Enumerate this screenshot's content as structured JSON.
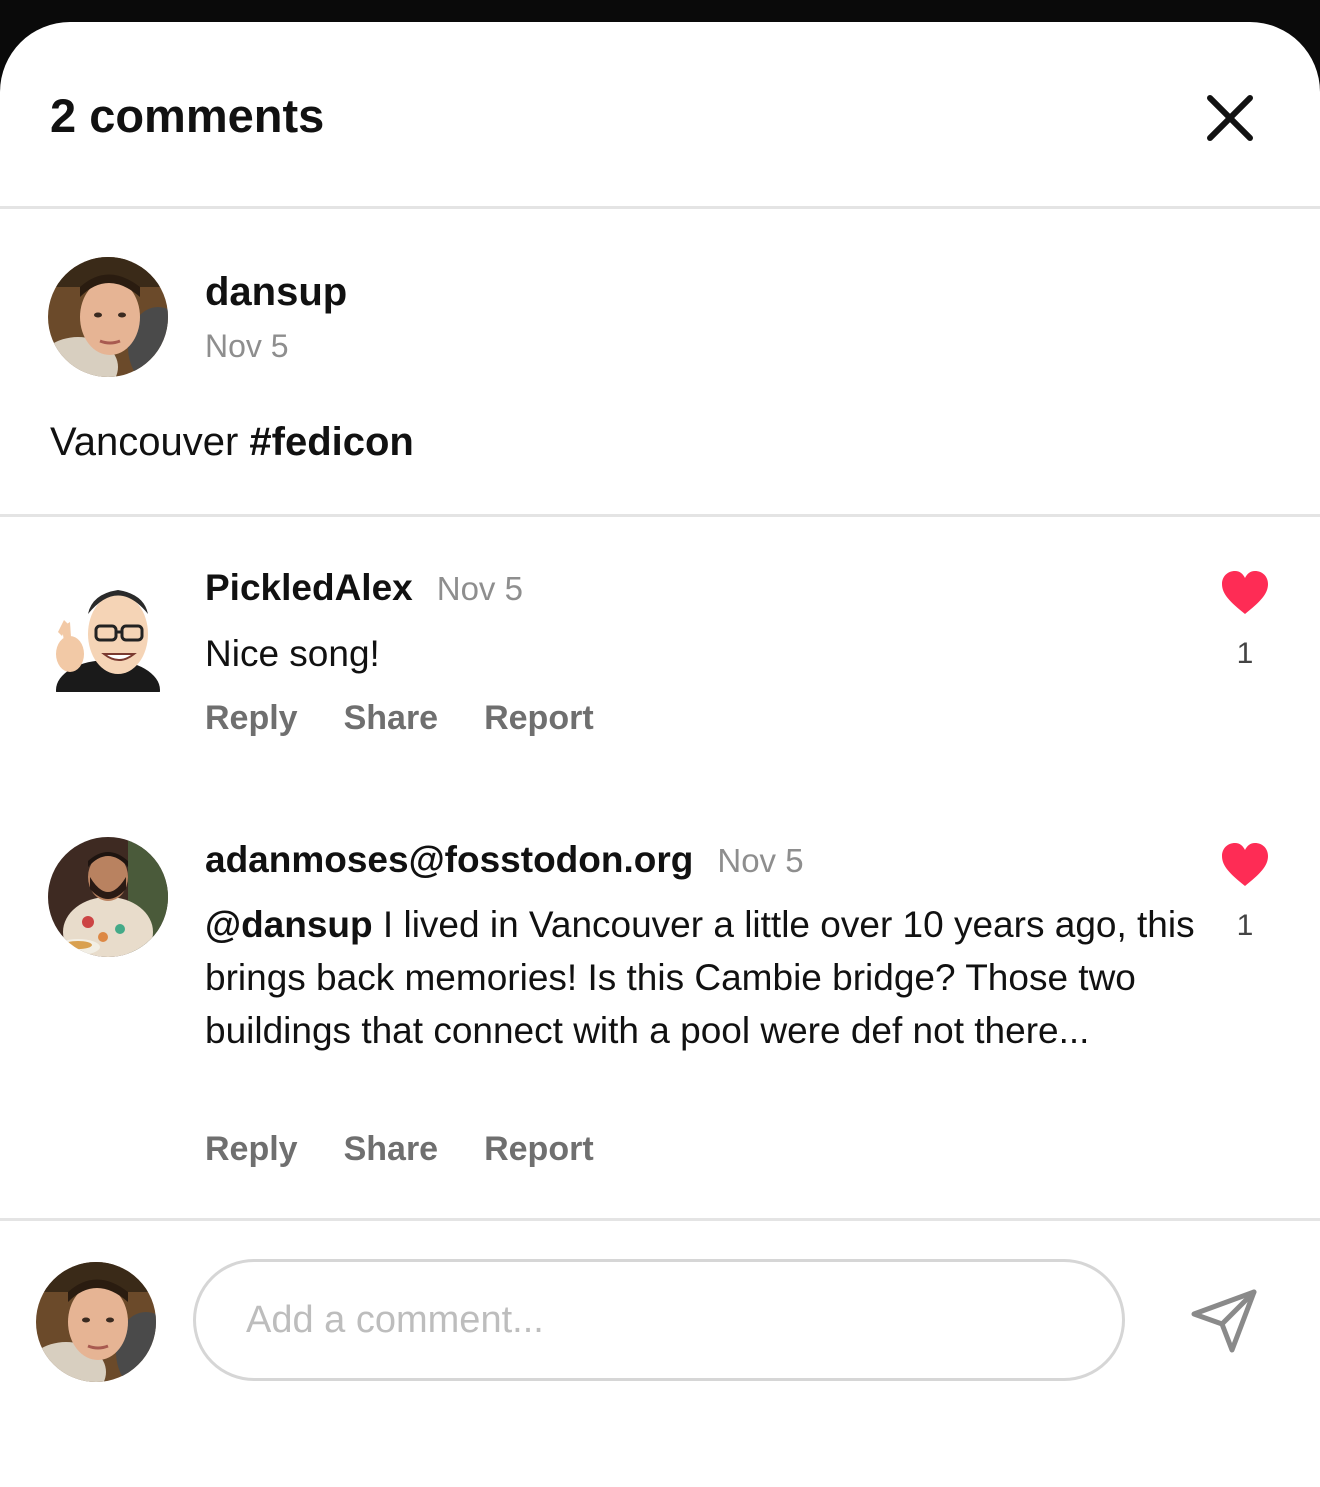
{
  "header": {
    "title": "2 comments"
  },
  "post": {
    "username": "dansup",
    "date": "Nov 5",
    "caption_text": "Vancouver ",
    "caption_tag": "#fedicon"
  },
  "comments": [
    {
      "username": "PickledAlex",
      "date": "Nov 5",
      "mention": "",
      "text": "Nice song!",
      "likes": "1",
      "actions": {
        "reply": "Reply",
        "share": "Share",
        "report": "Report"
      }
    },
    {
      "username": "adanmoses@fosstodon.org",
      "date": "Nov 5",
      "mention": "@dansup",
      "text": " I lived in Vancouver a little over 10 years ago, this brings back memories! Is this Cambie bridge? Those two buildings that connect with a pool were def not there...",
      "likes": "1",
      "actions": {
        "reply": "Reply",
        "share": "Share",
        "report": "Report"
      }
    }
  ],
  "composer": {
    "placeholder": "Add a comment..."
  },
  "icons": {
    "close": "close-icon",
    "like": "heart-icon",
    "send": "send-icon"
  },
  "colors": {
    "heart": "#fe2c55",
    "muted": "#8e8e8e",
    "action": "#6f6f6f"
  }
}
